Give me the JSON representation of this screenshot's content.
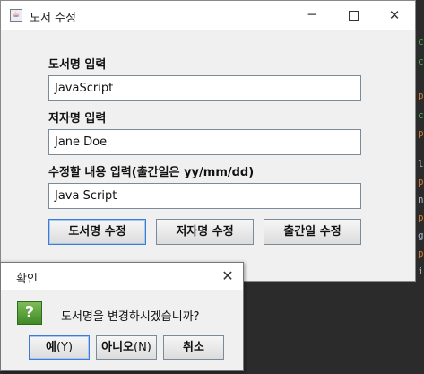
{
  "window": {
    "title": "도서 수정",
    "icon": "java-cup-icon",
    "controls": {
      "minimize": "─",
      "maximize": "",
      "close": "✕"
    }
  },
  "form": {
    "title_label": "도서명 입력",
    "title_value": "JavaScript",
    "author_label": "저자명 입력",
    "author_value": "Jane Doe",
    "edit_label": "수정할 내용 입력(출간일은 yy/mm/dd)",
    "edit_value": "Java Script"
  },
  "buttons": {
    "edit_title": "도서명 수정",
    "edit_author": "저자명 수정",
    "edit_date": "출간일 수정"
  },
  "dialog": {
    "title": "확인",
    "close": "✕",
    "icon": "question-icon",
    "icon_glyph": "?",
    "message": "도서명을 변경하시겠습니까?",
    "yes_label": "예",
    "yes_mnemonic": "(Y)",
    "no_label": "아니오",
    "no_mnemonic": "(N)",
    "cancel_label": "취소"
  },
  "background": {
    "frags": [
      "c",
      "c",
      "p",
      "c",
      "p",
      "l",
      "p",
      "n",
      "p",
      "g",
      "p",
      "i",
      ")",
      "L",
      "};",
      "=",
      "(",
      ";",
      ";"
    ]
  },
  "colors": {
    "window_bg": "#f0f0f0",
    "desktop_bg": "#2b2b2b",
    "focus_border": "#3d7bd6",
    "question_icon": "#4e9a31"
  }
}
